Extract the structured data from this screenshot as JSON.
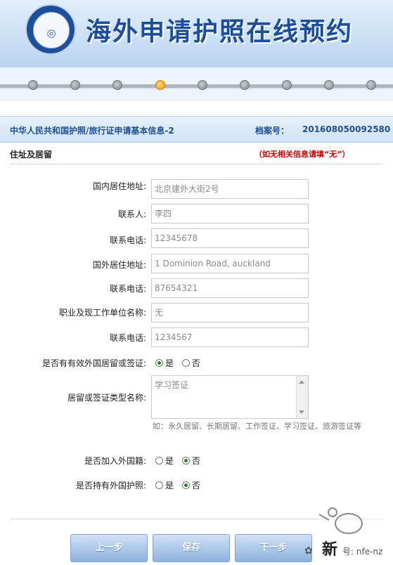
{
  "header": {
    "title": "海外申请护照在线预约"
  },
  "progress": {
    "step_count": 9,
    "active_step": 4
  },
  "section": {
    "title": "中华人民共和国护照/旅行证申请基本信息-2",
    "file_label": "档案号：",
    "file_number": "201608050092580"
  },
  "subsection": {
    "title": "住址及居留",
    "hint": "（如无相关信息请填“无”）"
  },
  "form": {
    "domestic_address": {
      "label": "国内居住地址:",
      "value": "北京建外大街2号"
    },
    "contact_person": {
      "label": "联系人:",
      "value": "李四"
    },
    "contact_phone": {
      "label": "联系电话:",
      "value": "12345678"
    },
    "overseas_address": {
      "label": "国外居住地址:",
      "value": "1 Dominion Road, auckland"
    },
    "overseas_phone": {
      "label": "联系电话:",
      "value": "87654321"
    },
    "occupation": {
      "label": "职业及现工作单位名称:",
      "value": "无"
    },
    "work_phone": {
      "label": "联系电话:",
      "value": "1234567"
    },
    "valid_residence": {
      "label": "是否有有效外国居留或签证:",
      "options": [
        "是",
        "否"
      ],
      "selected": "是"
    },
    "residence_type": {
      "label": "居留或签证类型名称:",
      "value": "学习签证",
      "example": "如：永久居留、长期居留、工作签证、学习签证、旅游签证等"
    },
    "foreign_nationality": {
      "label": "是否加入外国籍:",
      "options": [
        "是",
        "否"
      ],
      "selected": "否"
    },
    "foreign_passport": {
      "label": "是否持有外国护照:",
      "options": [
        "是",
        "否"
      ],
      "selected": "否"
    }
  },
  "buttons": {
    "prev": "上一步",
    "save": "保存",
    "next": "下一步"
  },
  "watermark": {
    "text": "新",
    "subtext": "号: nfe-nz"
  },
  "colors": {
    "brand_blue": "#1b4d98",
    "hint_red": "#cc0000",
    "active_step": "#f29b0d"
  }
}
